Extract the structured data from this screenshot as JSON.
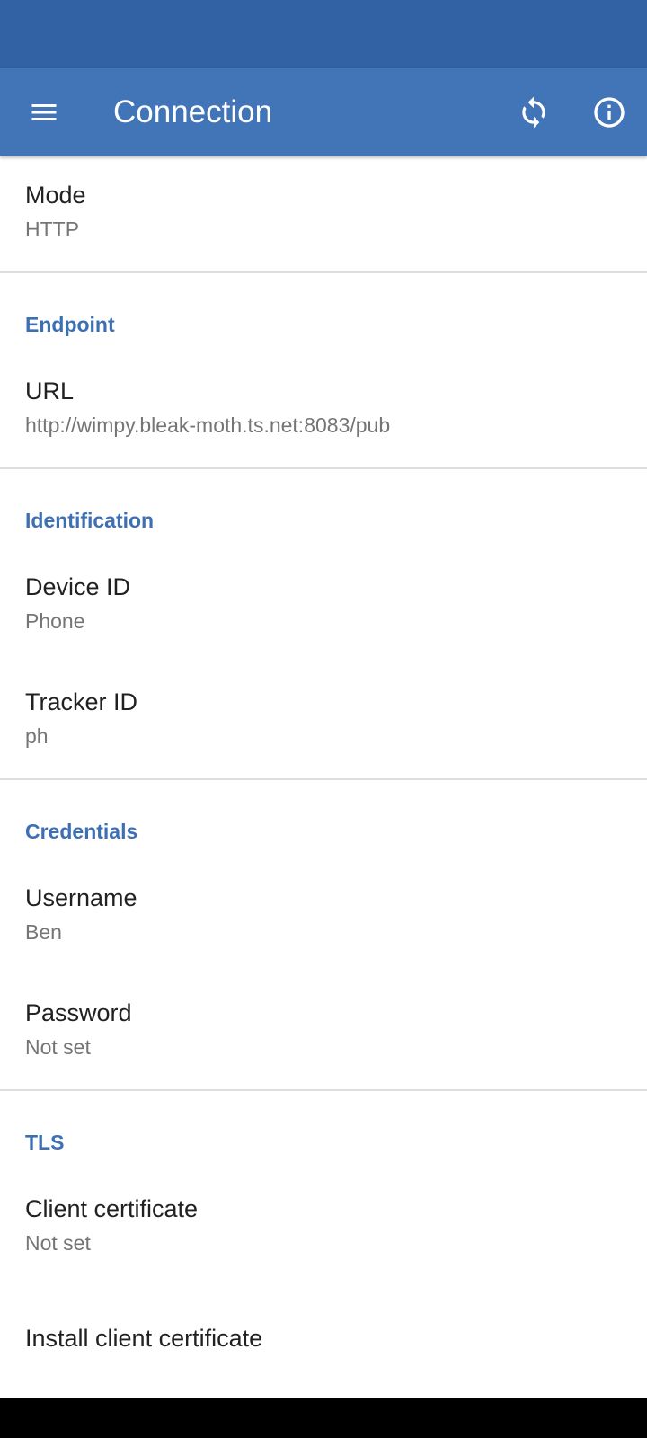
{
  "app_bar": {
    "title": "Connection",
    "icons": [
      "menu-icon",
      "refresh-icon",
      "info-icon"
    ],
    "color": "#4274b8"
  },
  "status_bar": {
    "color": "#3262a4"
  },
  "settings": {
    "mode": {
      "title": "Mode",
      "summary": "HTTP"
    },
    "endpoint": {
      "category": "Endpoint",
      "url": {
        "title": "URL",
        "summary": "http://wimpy.bleak-moth.ts.net:8083/pub"
      }
    },
    "identification": {
      "category": "Identification",
      "device_id": {
        "title": "Device ID",
        "summary": "Phone"
      },
      "tracker_id": {
        "title": "Tracker ID",
        "summary": "ph"
      }
    },
    "credentials": {
      "category": "Credentials",
      "username": {
        "title": "Username",
        "summary": "Ben"
      },
      "password": {
        "title": "Password",
        "summary": "Not set"
      }
    },
    "tls": {
      "category": "TLS",
      "client_certificate": {
        "title": "Client certificate",
        "summary": "Not set"
      },
      "install_client_certificate": {
        "title": "Install client certificate"
      }
    }
  },
  "colors": {
    "accent": "#3d6fb4",
    "primary_text": "#212121",
    "secondary_text": "#757575",
    "divider": "#dddddd"
  }
}
